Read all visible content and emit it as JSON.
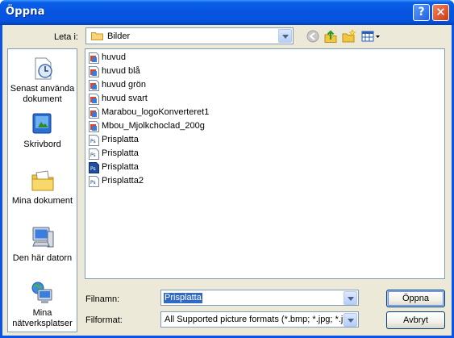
{
  "window": {
    "title": "Öppna",
    "help_glyph": "?",
    "close_glyph": "✕"
  },
  "lookin": {
    "label": "Leta i:",
    "value": "Bilder"
  },
  "toolbar": {
    "icons": [
      "back-icon",
      "up-folder-icon",
      "new-folder-icon",
      "view-menu-icon"
    ]
  },
  "places": [
    {
      "label": "Senast använda dokument",
      "icon": "recent-documents-icon"
    },
    {
      "label": "Skrivbord",
      "icon": "desktop-icon"
    },
    {
      "label": "Mina dokument",
      "icon": "my-documents-icon"
    },
    {
      "label": "Den här datorn",
      "icon": "my-computer-icon"
    },
    {
      "label": "Mina nätverksplatser",
      "icon": "network-places-icon"
    }
  ],
  "files": [
    {
      "name": "huvud",
      "type": "image"
    },
    {
      "name": "huvud blå",
      "type": "image"
    },
    {
      "name": "huvud grön",
      "type": "image"
    },
    {
      "name": "huvud svart",
      "type": "image"
    },
    {
      "name": "Marabou_logoKonverteret1",
      "type": "image"
    },
    {
      "name": "Mbou_Mjolkchoclad_200g",
      "type": "image"
    },
    {
      "name": "Prisplatta",
      "type": "psd"
    },
    {
      "name": "Prisplatta",
      "type": "psd"
    },
    {
      "name": "Prisplatta",
      "type": "psd-photoshop"
    },
    {
      "name": "Prisplatta2",
      "type": "psd"
    }
  ],
  "filename": {
    "label": "Filnamn:",
    "value": "Prisplatta"
  },
  "fileformat": {
    "label": "Filformat:",
    "value": "All Supported picture formats (*.bmp; *.jpg; *.jpe"
  },
  "buttons": {
    "open": "Öppna",
    "cancel": "Avbryt"
  },
  "colors": {
    "titlebar": "#0a5fe8",
    "selection": "#316ac5",
    "dialog_bg": "#ece9d8"
  }
}
